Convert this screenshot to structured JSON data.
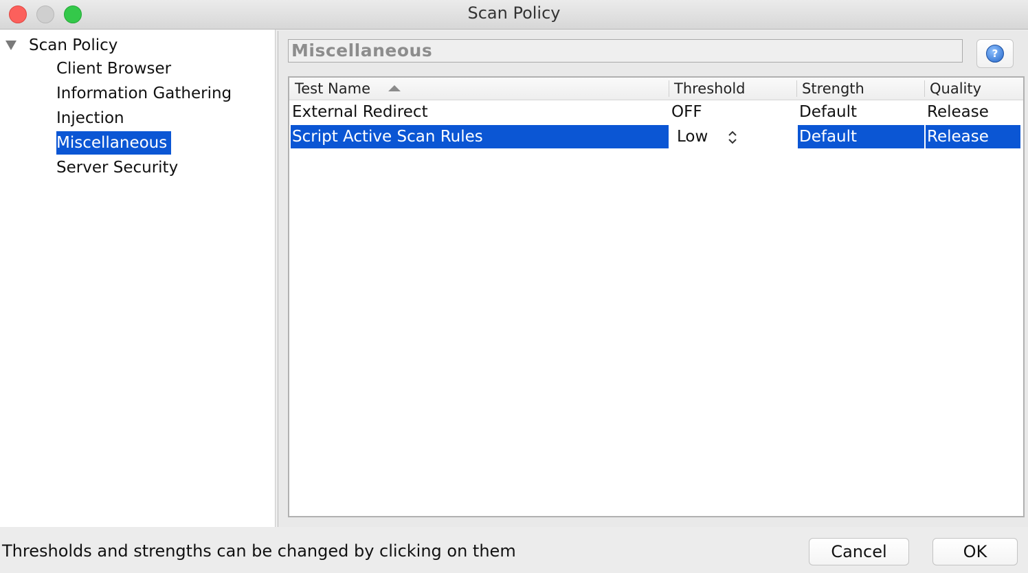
{
  "window": {
    "title": "Scan Policy"
  },
  "tree": {
    "root": "Scan Policy",
    "items": [
      {
        "label": "Client Browser"
      },
      {
        "label": "Information Gathering"
      },
      {
        "label": "Injection"
      },
      {
        "label": "Miscellaneous",
        "selected": true
      },
      {
        "label": "Server Security"
      }
    ]
  },
  "panel": {
    "title": "Miscellaneous",
    "help_icon": "help-icon"
  },
  "table": {
    "columns": [
      "Test Name",
      "Threshold",
      "Strength",
      "Quality"
    ],
    "sort": {
      "column": "Test Name",
      "direction": "ascending"
    },
    "rows": [
      {
        "name": "External Redirect",
        "threshold": "OFF",
        "strength": "Default",
        "quality": "Release"
      },
      {
        "name": "Script Active Scan Rules",
        "threshold": "Low",
        "strength": "Default",
        "quality": "Release",
        "selected": true
      }
    ]
  },
  "footer": {
    "status": "Thresholds and strengths can be changed by clicking on them",
    "cancel": "Cancel",
    "ok": "OK"
  },
  "colors": {
    "selection": "#0b56d4"
  }
}
